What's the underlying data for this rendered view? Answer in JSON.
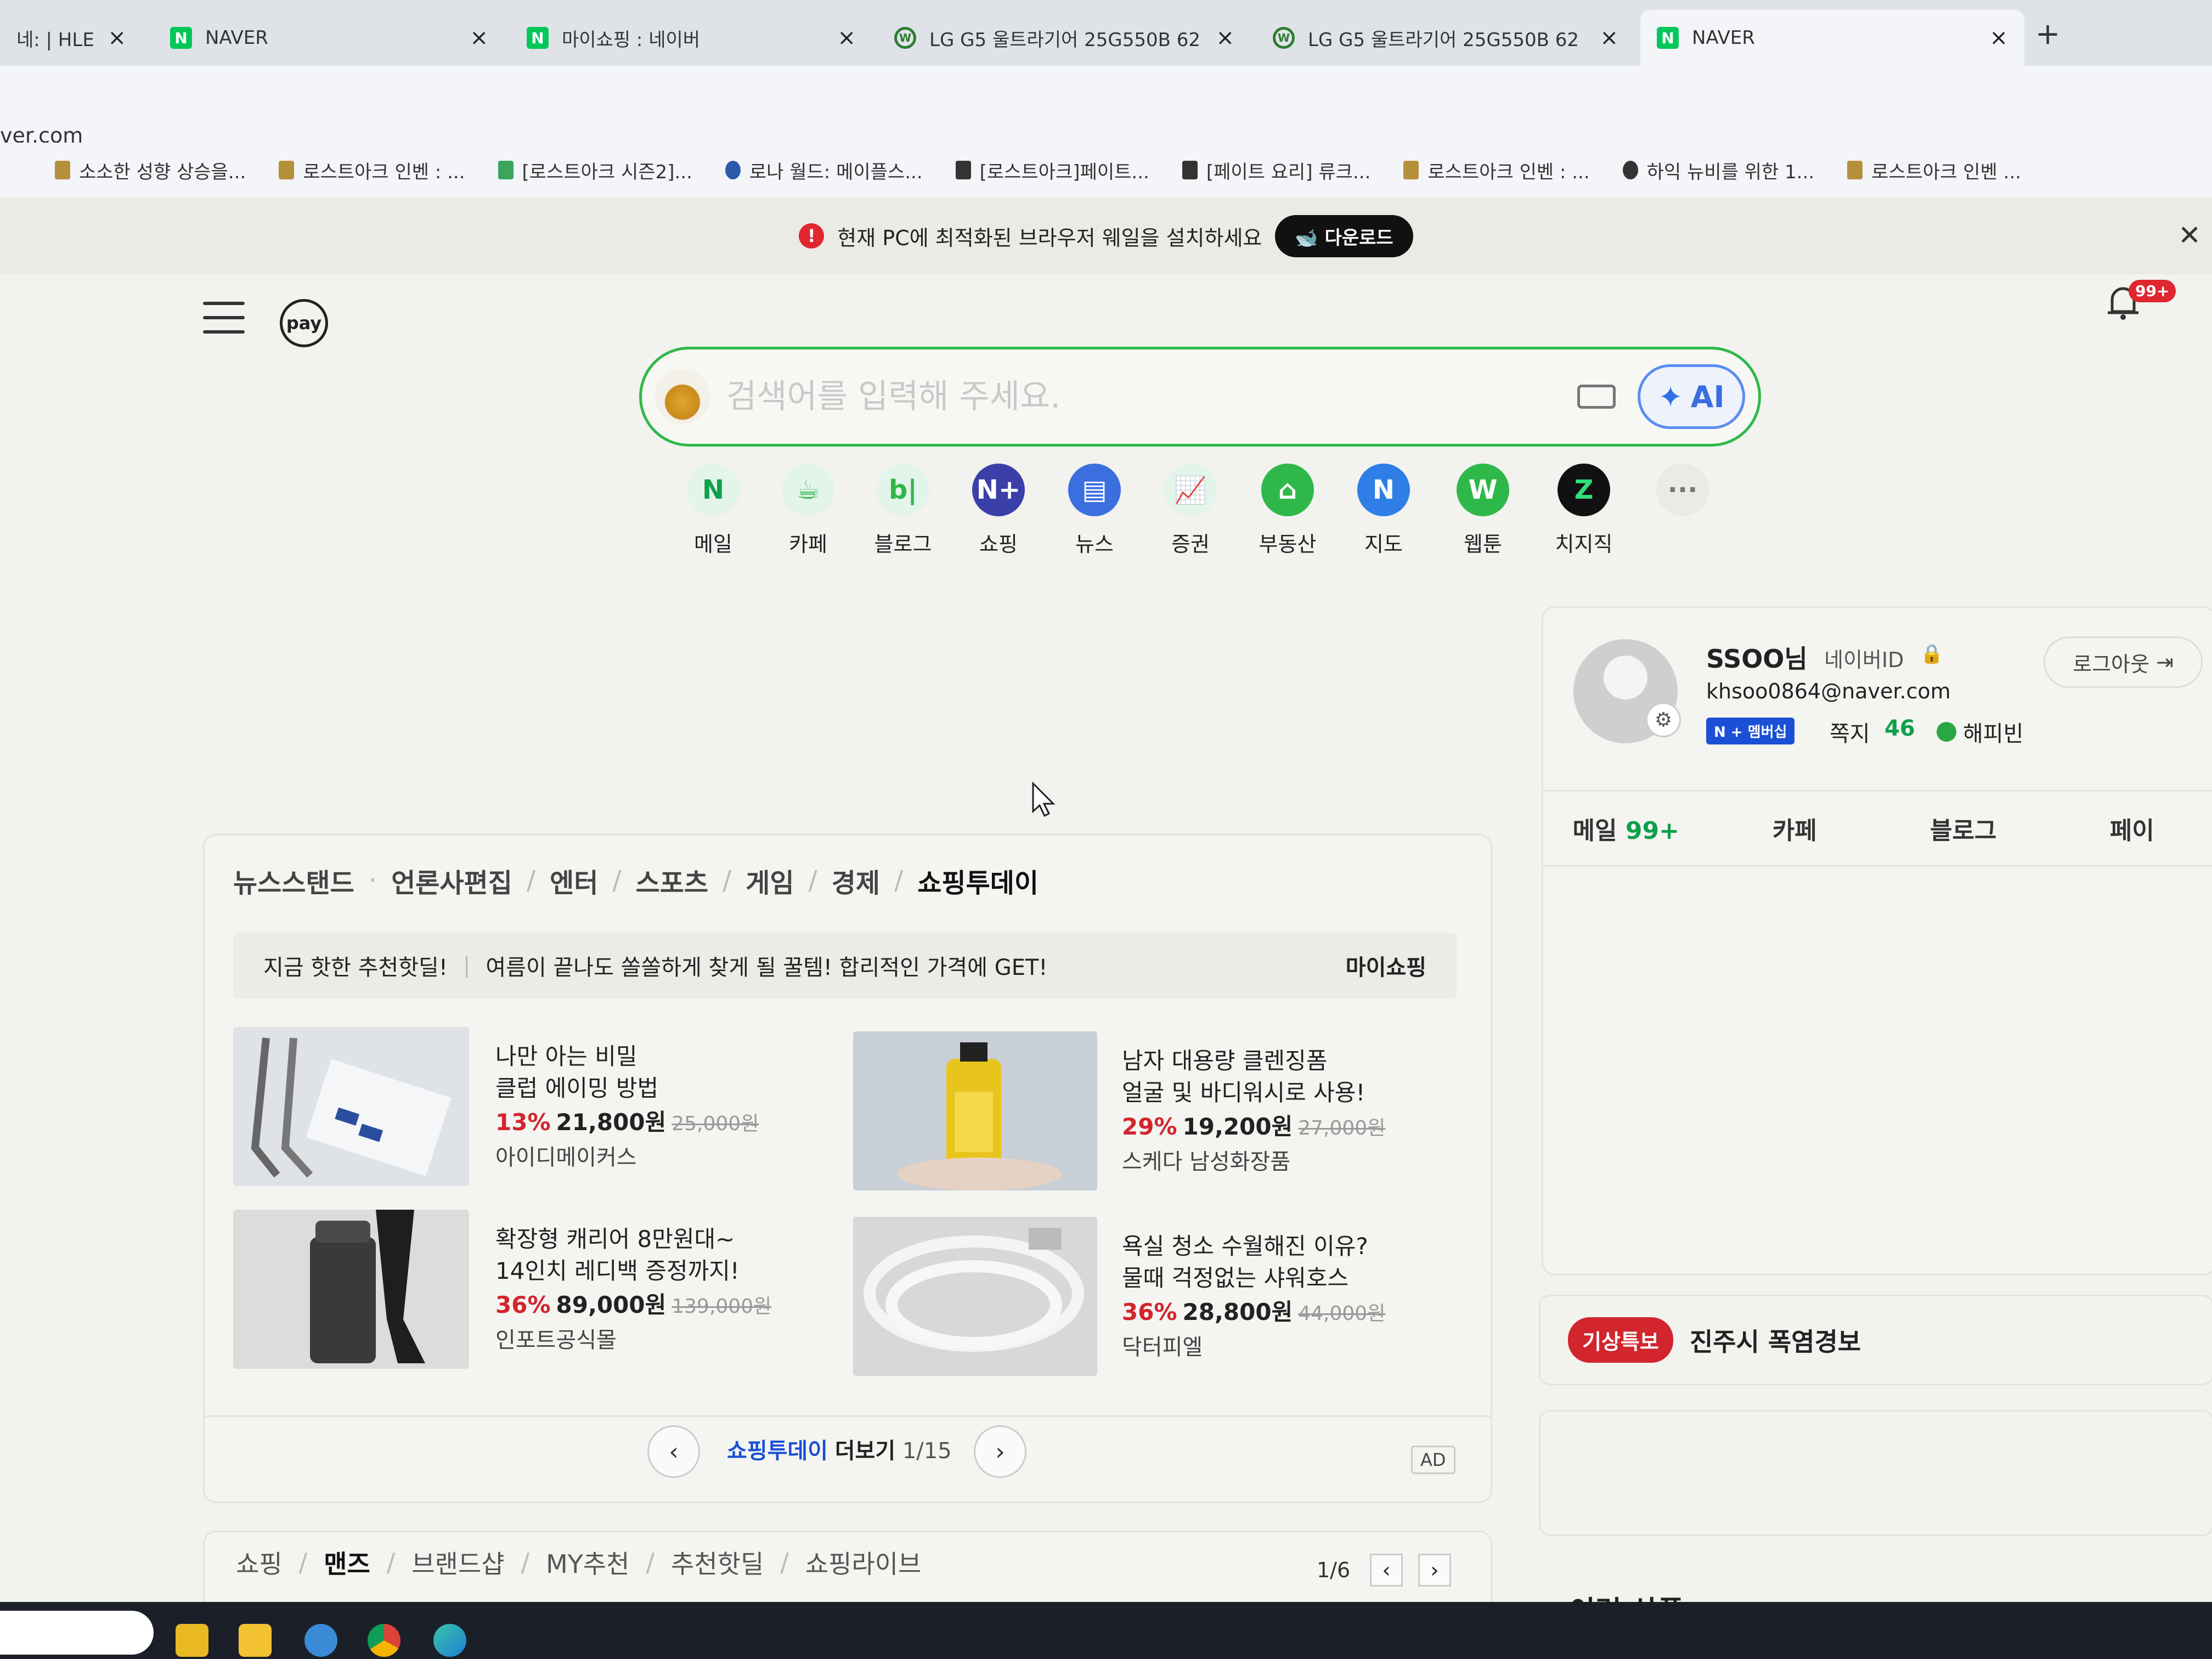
{
  "browser": {
    "tabs": [
      {
        "title": "네: | HLE v",
        "icon": "hle-icon"
      },
      {
        "title": "NAVER",
        "icon": "naver-n-icon"
      },
      {
        "title": "마이쇼핑 : 네이버",
        "icon": "naver-n-icon"
      },
      {
        "title": "LG G5 울트라기어 25G550B 62",
        "icon": "danawa-icon"
      },
      {
        "title": "LG G5 울트라기어 25G550B 62",
        "icon": "danawa-icon"
      },
      {
        "title": "NAVER",
        "icon": "naver-n-icon"
      }
    ],
    "new_tab": "+",
    "close": "×",
    "url": "ver.com",
    "bookmarks": [
      "소소한 성향 상승을...",
      "로스트아크 인벤 : ...",
      "[로스트아크 시즌2]...",
      "로나 월드: 메이플스...",
      "[로스트아크]페이트...",
      "[페이트 요리] 류크...",
      "로스트아크 인벤 : ...",
      "하익 뉴비를 위한 1...",
      "로스트아크 인벤 ..."
    ]
  },
  "notice": {
    "text": "현재 PC에 최적화된 브라우저 웨일을 설치하세요",
    "download": "다운로드",
    "close": "✕"
  },
  "header": {
    "pay": "pay",
    "bell_badge": "99+"
  },
  "search": {
    "placeholder": "검색어를 입력해 주세요.",
    "ai_label": "AI"
  },
  "shortcuts": [
    {
      "label": "메일",
      "glyph": "N",
      "color": "#0e9f4a",
      "bg": "#e3f4ea"
    },
    {
      "label": "카페",
      "glyph": "☕",
      "color": "#2fb84a",
      "bg": "#e3f4ea"
    },
    {
      "label": "블로그",
      "glyph": "b|",
      "color": "#2fb84a",
      "bg": "#e3f4ea"
    },
    {
      "label": "쇼핑",
      "glyph": "N+",
      "color": "#ffffff",
      "bg": "#3b3fa8"
    },
    {
      "label": "뉴스",
      "glyph": "▤",
      "color": "#ffffff",
      "bg": "#3b6fe0"
    },
    {
      "label": "증권",
      "glyph": "📈",
      "color": "#2fb84a",
      "bg": "#e3f4ea"
    },
    {
      "label": "부동산",
      "glyph": "⌂",
      "color": "#ffffff",
      "bg": "#2fb84a"
    },
    {
      "label": "지도",
      "glyph": "N",
      "color": "#ffffff",
      "bg": "#2f7ee8"
    },
    {
      "label": "웹툰",
      "glyph": "W",
      "color": "#ffffff",
      "bg": "#2fb84a"
    },
    {
      "label": "치지직",
      "glyph": "Z",
      "color": "#2fe07a",
      "bg": "#111111"
    },
    {
      "label": "",
      "glyph": "···",
      "color": "#777777",
      "bg": "#ebebe6"
    }
  ],
  "profile": {
    "name": "SSOO님",
    "naver_id": "네이버ID",
    "email": "khsoo0864@naver.com",
    "membership": "N + 멤버십",
    "note_label": "쪽지",
    "note_count": "46",
    "happybean": "해피빈",
    "logout": "로그아웃",
    "tabs": [
      {
        "label": "메일",
        "count": "99+"
      },
      {
        "label": "카페",
        "count": ""
      },
      {
        "label": "블로그",
        "count": ""
      },
      {
        "label": "페이",
        "count": ""
      }
    ]
  },
  "weather": {
    "tag": "기상특보",
    "text": "진주시 폭염경보"
  },
  "reco_title": "이런 상품",
  "news": {
    "tabs": [
      "뉴스스탠드",
      "언론사편집",
      "엔터",
      "스포츠",
      "게임",
      "경제",
      "쇼핑투데이"
    ],
    "active_tab": "쇼핑투데이",
    "sub": {
      "hot": "지금 핫한 추천핫딜!",
      "desc": "여름이 끝나도 쏠쏠하게 찾게 될 꿀템! 합리적인 가격에 GET!",
      "myshop": "마이쇼핑"
    },
    "products": [
      {
        "line1": "나만 아는 비밀",
        "line2": "클럽 에이밍 방법",
        "pct": "13%",
        "price": "21,800원",
        "old": "25,000원",
        "seller": "아이디메이커스"
      },
      {
        "line1": "남자 대용량 클렌징폼",
        "line2": "얼굴 및 바디워시로 사용!",
        "pct": "29%",
        "price": "19,200원",
        "old": "27,000원",
        "seller": "스케다 남성화장품"
      },
      {
        "line1": "확장형 캐리어 8만원대~",
        "line2": "14인치 레디백 증정까지!",
        "pct": "36%",
        "price": "89,000원",
        "old": "139,000원",
        "seller": "인포트공식몰"
      },
      {
        "line1": "욕실 청소 수월해진 이유?",
        "line2": "물때 걱정없는 샤워호스",
        "pct": "36%",
        "price": "28,800원",
        "old": "44,000원",
        "seller": "닥터피엘"
      }
    ],
    "pager": {
      "brand": "쇼핑투데이",
      "more": "더보기",
      "page": "1/15",
      "ad": "AD"
    }
  },
  "lower": {
    "tabs": [
      "쇼핑",
      "맨즈",
      "브랜드샵",
      "MY추천",
      "추천핫딜",
      "쇼핑라이브"
    ],
    "active_tab": "맨즈",
    "page": "1/6"
  }
}
